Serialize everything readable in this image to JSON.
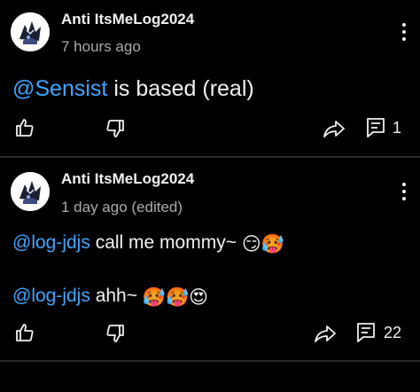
{
  "comments": [
    {
      "author": "Anti ItsMeLog2024",
      "time": "7 hours ago",
      "mention": "@Sensist",
      "text": " is based (real)",
      "reply_count": "1"
    },
    {
      "author": "Anti ItsMeLog2024",
      "time": "1 day ago (edited)",
      "line1_mention": "@log-jdjs",
      "line1_text": " call me mommy~ ",
      "line1_emojis": "😏🥵",
      "line2_mention": "@log-jdjs",
      "line2_text": " ahh~ ",
      "line2_emojis": "🥵🥵😍",
      "reply_count": "22"
    }
  ],
  "icons": {
    "like": "thumbs-up-icon",
    "dislike": "thumbs-down-icon",
    "share": "share-icon",
    "reply": "reply-comment-icon",
    "more": "more-vertical-icon"
  },
  "colors": {
    "background": "#000000",
    "mention": "#3ea6ff",
    "meta": "#aaaaaa",
    "text": "#f1f1f1"
  }
}
